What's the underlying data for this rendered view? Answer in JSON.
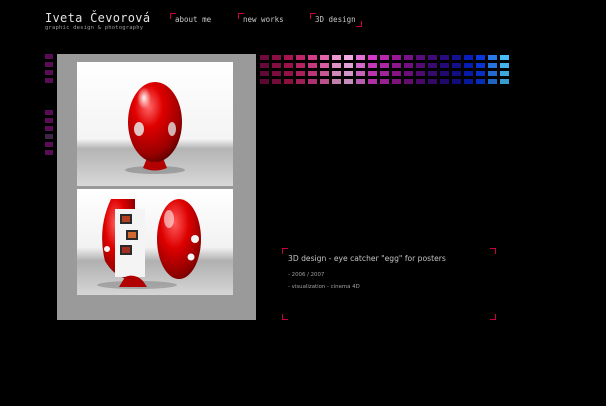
{
  "header": {
    "site_name": "Iveta Čevorová",
    "tagline": "graphic design & photography"
  },
  "nav": [
    {
      "label": "about me",
      "active": false
    },
    {
      "label": "new works",
      "active": false
    },
    {
      "label": "3D design",
      "active": true
    }
  ],
  "colors": {
    "background": "#000000",
    "accent": "#c9003c",
    "frame": "#9a9a9a"
  },
  "gallery": {
    "images": [
      {
        "subject": "red egg-shaped kiosk, closed"
      },
      {
        "subject": "red egg-shaped kiosk, open with posters"
      }
    ]
  },
  "project": {
    "title": "3D design - eye catcher \"egg\" for posters",
    "year": "- 2006 / 2007",
    "details": "- visualization - cinema 4D"
  }
}
